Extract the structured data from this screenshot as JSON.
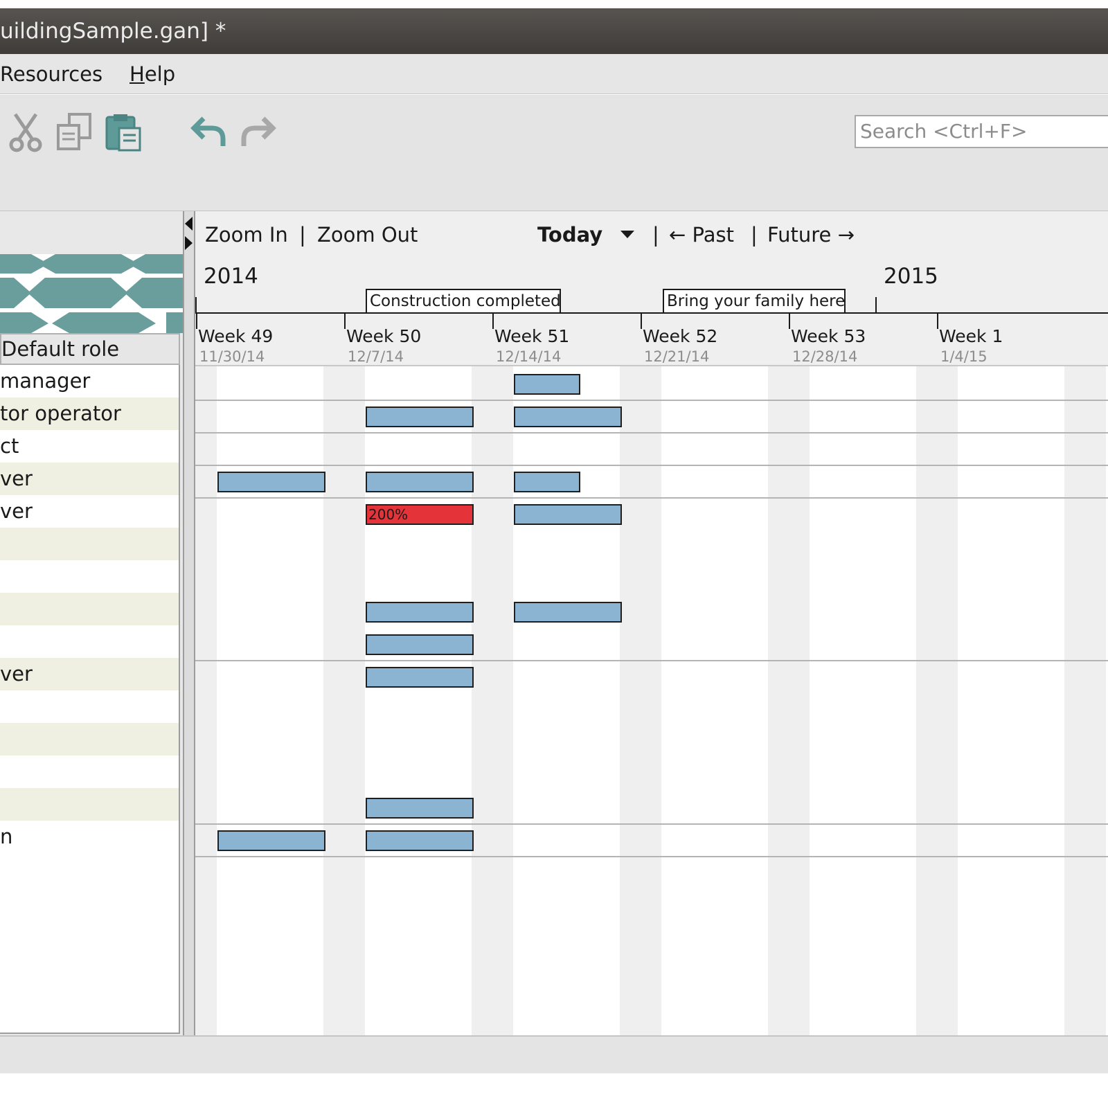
{
  "window": {
    "title": "uildingSample.gan] *"
  },
  "menu": {
    "resources": "Resources",
    "help": "Help"
  },
  "toolbar": {
    "search_placeholder": "Search <Ctrl+F>",
    "icons": [
      "cut-icon",
      "copy-icon",
      "paste-icon",
      "undo-icon",
      "redo-icon"
    ]
  },
  "left_panel": {
    "column_header": "Default role",
    "rows": [
      "manager",
      "tor operator",
      "ct",
      "ver",
      "ver",
      "",
      "",
      "",
      "",
      "ver",
      "",
      "",
      "",
      "",
      "n"
    ]
  },
  "chart_nav": {
    "zoom_in": "Zoom In",
    "zoom_out": "Zoom Out",
    "today": "Today",
    "past": "← Past",
    "future": "Future →",
    "sep": "|"
  },
  "timeline": {
    "years": [
      "2014",
      "2015"
    ],
    "milestones": [
      "Construction completed",
      "Bring your family here"
    ],
    "weeks": [
      {
        "label": "Week 49",
        "date": "11/30/14"
      },
      {
        "label": "Week 50",
        "date": "12/7/14"
      },
      {
        "label": "Week 51",
        "date": "12/14/14"
      },
      {
        "label": "Week 52",
        "date": "12/21/14"
      },
      {
        "label": "Week 53",
        "date": "12/28/14"
      },
      {
        "label": "Week 1",
        "date": "1/4/15"
      }
    ]
  },
  "overload_label": "200%",
  "colors": {
    "bar": "#8ab4d2",
    "overload": "#e5333a",
    "logo": "#6a9e9c"
  }
}
